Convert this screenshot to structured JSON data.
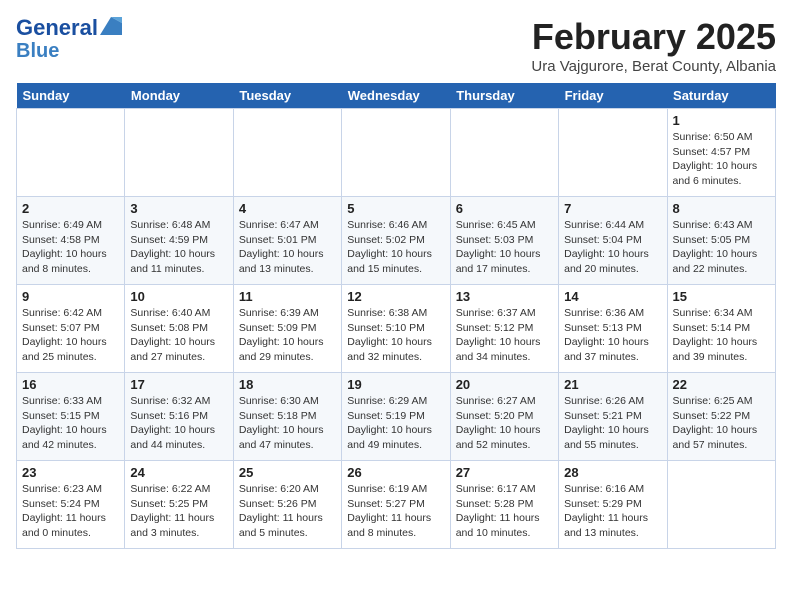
{
  "logo": {
    "line1": "General",
    "line2": "Blue"
  },
  "title": "February 2025",
  "location": "Ura Vajgurore, Berat County, Albania",
  "weekdays": [
    "Sunday",
    "Monday",
    "Tuesday",
    "Wednesday",
    "Thursday",
    "Friday",
    "Saturday"
  ],
  "weeks": [
    [
      {
        "day": "",
        "info": ""
      },
      {
        "day": "",
        "info": ""
      },
      {
        "day": "",
        "info": ""
      },
      {
        "day": "",
        "info": ""
      },
      {
        "day": "",
        "info": ""
      },
      {
        "day": "",
        "info": ""
      },
      {
        "day": "1",
        "info": "Sunrise: 6:50 AM\nSunset: 4:57 PM\nDaylight: 10 hours and 6 minutes."
      }
    ],
    [
      {
        "day": "2",
        "info": "Sunrise: 6:49 AM\nSunset: 4:58 PM\nDaylight: 10 hours and 8 minutes."
      },
      {
        "day": "3",
        "info": "Sunrise: 6:48 AM\nSunset: 4:59 PM\nDaylight: 10 hours and 11 minutes."
      },
      {
        "day": "4",
        "info": "Sunrise: 6:47 AM\nSunset: 5:01 PM\nDaylight: 10 hours and 13 minutes."
      },
      {
        "day": "5",
        "info": "Sunrise: 6:46 AM\nSunset: 5:02 PM\nDaylight: 10 hours and 15 minutes."
      },
      {
        "day": "6",
        "info": "Sunrise: 6:45 AM\nSunset: 5:03 PM\nDaylight: 10 hours and 17 minutes."
      },
      {
        "day": "7",
        "info": "Sunrise: 6:44 AM\nSunset: 5:04 PM\nDaylight: 10 hours and 20 minutes."
      },
      {
        "day": "8",
        "info": "Sunrise: 6:43 AM\nSunset: 5:05 PM\nDaylight: 10 hours and 22 minutes."
      }
    ],
    [
      {
        "day": "9",
        "info": "Sunrise: 6:42 AM\nSunset: 5:07 PM\nDaylight: 10 hours and 25 minutes."
      },
      {
        "day": "10",
        "info": "Sunrise: 6:40 AM\nSunset: 5:08 PM\nDaylight: 10 hours and 27 minutes."
      },
      {
        "day": "11",
        "info": "Sunrise: 6:39 AM\nSunset: 5:09 PM\nDaylight: 10 hours and 29 minutes."
      },
      {
        "day": "12",
        "info": "Sunrise: 6:38 AM\nSunset: 5:10 PM\nDaylight: 10 hours and 32 minutes."
      },
      {
        "day": "13",
        "info": "Sunrise: 6:37 AM\nSunset: 5:12 PM\nDaylight: 10 hours and 34 minutes."
      },
      {
        "day": "14",
        "info": "Sunrise: 6:36 AM\nSunset: 5:13 PM\nDaylight: 10 hours and 37 minutes."
      },
      {
        "day": "15",
        "info": "Sunrise: 6:34 AM\nSunset: 5:14 PM\nDaylight: 10 hours and 39 minutes."
      }
    ],
    [
      {
        "day": "16",
        "info": "Sunrise: 6:33 AM\nSunset: 5:15 PM\nDaylight: 10 hours and 42 minutes."
      },
      {
        "day": "17",
        "info": "Sunrise: 6:32 AM\nSunset: 5:16 PM\nDaylight: 10 hours and 44 minutes."
      },
      {
        "day": "18",
        "info": "Sunrise: 6:30 AM\nSunset: 5:18 PM\nDaylight: 10 hours and 47 minutes."
      },
      {
        "day": "19",
        "info": "Sunrise: 6:29 AM\nSunset: 5:19 PM\nDaylight: 10 hours and 49 minutes."
      },
      {
        "day": "20",
        "info": "Sunrise: 6:27 AM\nSunset: 5:20 PM\nDaylight: 10 hours and 52 minutes."
      },
      {
        "day": "21",
        "info": "Sunrise: 6:26 AM\nSunset: 5:21 PM\nDaylight: 10 hours and 55 minutes."
      },
      {
        "day": "22",
        "info": "Sunrise: 6:25 AM\nSunset: 5:22 PM\nDaylight: 10 hours and 57 minutes."
      }
    ],
    [
      {
        "day": "23",
        "info": "Sunrise: 6:23 AM\nSunset: 5:24 PM\nDaylight: 11 hours and 0 minutes."
      },
      {
        "day": "24",
        "info": "Sunrise: 6:22 AM\nSunset: 5:25 PM\nDaylight: 11 hours and 3 minutes."
      },
      {
        "day": "25",
        "info": "Sunrise: 6:20 AM\nSunset: 5:26 PM\nDaylight: 11 hours and 5 minutes."
      },
      {
        "day": "26",
        "info": "Sunrise: 6:19 AM\nSunset: 5:27 PM\nDaylight: 11 hours and 8 minutes."
      },
      {
        "day": "27",
        "info": "Sunrise: 6:17 AM\nSunset: 5:28 PM\nDaylight: 11 hours and 10 minutes."
      },
      {
        "day": "28",
        "info": "Sunrise: 6:16 AM\nSunset: 5:29 PM\nDaylight: 11 hours and 13 minutes."
      },
      {
        "day": "",
        "info": ""
      }
    ]
  ]
}
